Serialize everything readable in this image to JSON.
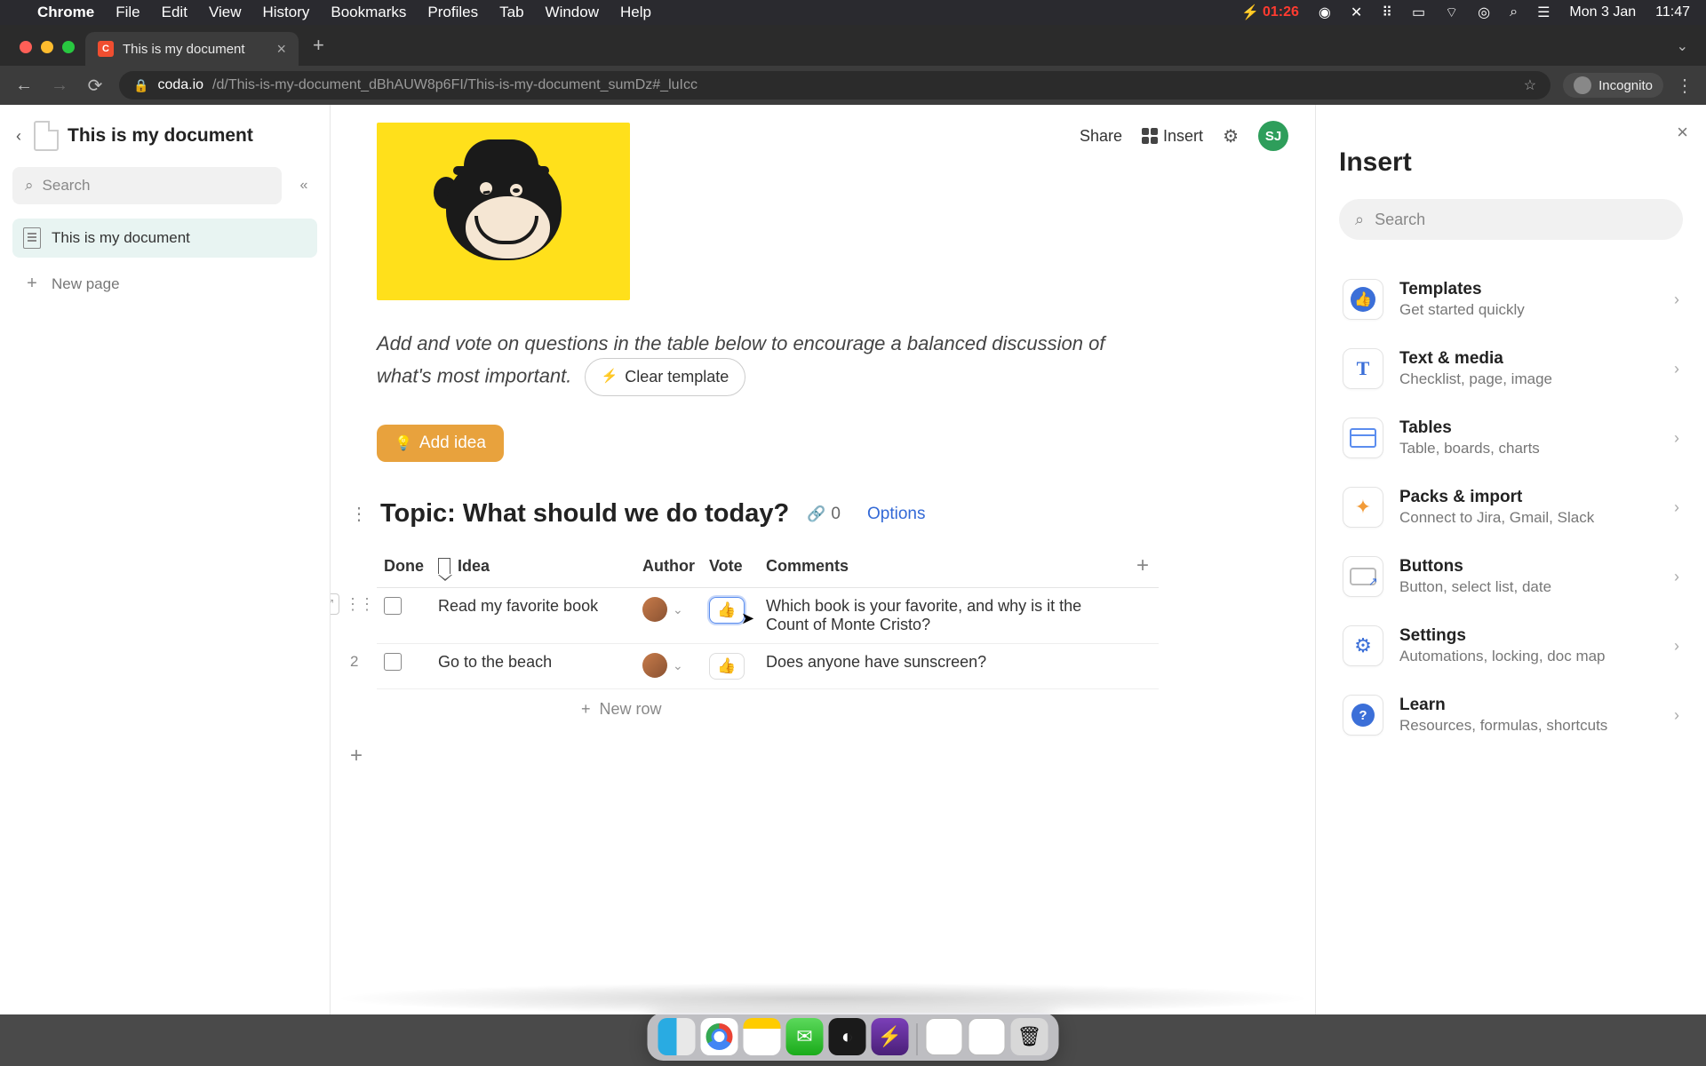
{
  "menubar": {
    "app": "Chrome",
    "items": [
      "File",
      "Edit",
      "View",
      "History",
      "Bookmarks",
      "Profiles",
      "Tab",
      "Window",
      "Help"
    ],
    "battery": "01:26",
    "date": "Mon 3 Jan",
    "time": "11:47"
  },
  "browser": {
    "tab_title": "This is my document",
    "url_host": "coda.io",
    "url_path": "/d/This-is-my-document_dBhAUW8p6FI/This-is-my-document_sumDz#_luIcc",
    "incognito_label": "Incognito"
  },
  "doc": {
    "title": "This is my document",
    "search_placeholder": "Search",
    "nav_item": "This is my document",
    "new_page": "New page"
  },
  "header": {
    "share": "Share",
    "insert": "Insert",
    "avatar_initials": "SJ"
  },
  "content": {
    "intro": "Add and vote on questions in the table below to encourage a balanced discussion of what's most important.",
    "clear_template": "Clear template",
    "add_idea": "Add idea",
    "topic_title": "Topic: What should we do today?",
    "link_count": "0",
    "options": "Options",
    "columns": {
      "done": "Done",
      "idea": "Idea",
      "author": "Author",
      "vote": "Vote",
      "comments": "Comments"
    },
    "rows": [
      {
        "num": "",
        "idea": "Read my favorite book",
        "comment": "Which book is your favorite, and why is it the Count of Monte Cristo?"
      },
      {
        "num": "2",
        "idea": "Go to the beach",
        "comment": "Does anyone have sunscreen?"
      }
    ],
    "new_row": "New row"
  },
  "panel": {
    "title": "Insert",
    "search_placeholder": "Search",
    "items": [
      {
        "title": "Templates",
        "sub": "Get started quickly"
      },
      {
        "title": "Text & media",
        "sub": "Checklist, page, image"
      },
      {
        "title": "Tables",
        "sub": "Table, boards, charts"
      },
      {
        "title": "Packs & import",
        "sub": "Connect to Jira, Gmail, Slack"
      },
      {
        "title": "Buttons",
        "sub": "Button, select list, date"
      },
      {
        "title": "Settings",
        "sub": "Automations, locking, doc map"
      },
      {
        "title": "Learn",
        "sub": "Resources, formulas, shortcuts"
      }
    ]
  }
}
